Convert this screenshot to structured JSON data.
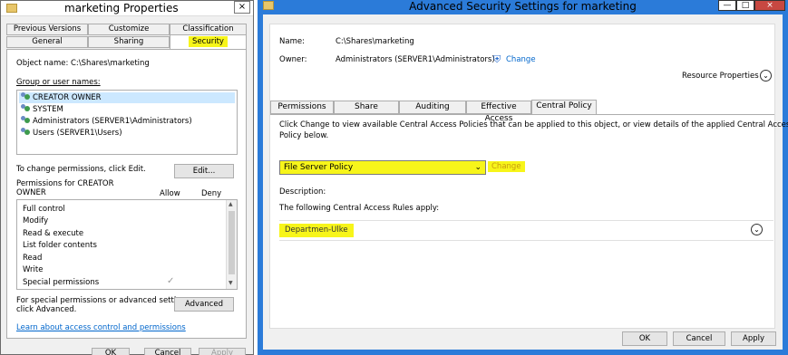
{
  "left": {
    "title": "marketing Properties",
    "tabs_row1": [
      "Previous Versions",
      "Customize",
      "Classification"
    ],
    "tabs_row2": [
      "General",
      "Sharing",
      "Security"
    ],
    "object_name_label": "Object name:",
    "object_name_value": "C:\\Shares\\marketing",
    "group_label": "Group or user names:",
    "groups": [
      "CREATOR OWNER",
      "SYSTEM",
      "Administrators (SERVER1\\Administrators)",
      "Users (SERVER1\\Users)"
    ],
    "change_perm_text": "To change permissions, click Edit.",
    "edit_button": "Edit...",
    "perm_for_line1": "Permissions for CREATOR",
    "perm_for_line2": "OWNER",
    "allow_header": "Allow",
    "deny_header": "Deny",
    "permissions": [
      "Full control",
      "Modify",
      "Read & execute",
      "List folder contents",
      "Read",
      "Write",
      "Special permissions"
    ],
    "special_check": "✓",
    "advanced_text_line1": "For special permissions or advanced settings,",
    "advanced_text_line2": "click Advanced.",
    "advanced_button": "Advanced",
    "learn_link": "Learn about access control and permissions",
    "ok_button": "OK",
    "cancel_button": "Cancel",
    "apply_button": "Apply",
    "close_glyph": "×"
  },
  "right": {
    "title": "Advanced Security Settings for marketing",
    "min_glyph": "—",
    "max_glyph": "□",
    "close_glyph": "×",
    "name_label": "Name:",
    "name_value": "C:\\Shares\\marketing",
    "owner_label": "Owner:",
    "owner_value": "Administrators (SERVER1\\Administrators)",
    "owner_change": "Change",
    "resource_properties": "Resource Properties",
    "tabs": [
      "Permissions",
      "Share",
      "Auditing",
      "Effective Access",
      "Central Policy"
    ],
    "desc_line1": "Click Change to view available Central Access Policies that can be applied to this object, or view details of the applied Central Access",
    "desc_line2": "Policy below.",
    "policy_selected": "File Server Policy",
    "policy_change": "Change",
    "description_label": "Description:",
    "rules_text": "The following Central Access Rules apply:",
    "rule_name": "Departmen-Ulke",
    "ok_button": "OK",
    "cancel_button": "Cancel",
    "apply_button": "Apply"
  },
  "colors": {
    "highlight": "#f7f51a",
    "titlebar": "#2b7bd9",
    "link": "#0066cc"
  }
}
